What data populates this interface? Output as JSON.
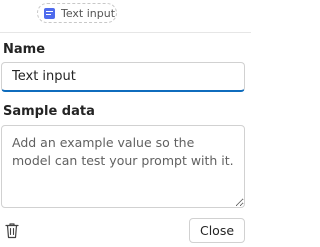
{
  "chip": {
    "label": "Text input",
    "icon": "text-input-icon",
    "icon_color": "#4f6bed"
  },
  "name_field": {
    "label": "Name",
    "value": "Text input"
  },
  "sample_field": {
    "label": "Sample data",
    "placeholder": "Add an example value so the model can test your prompt with it.",
    "value": ""
  },
  "actions": {
    "delete_icon": "trash-icon",
    "close_label": "Close"
  },
  "colors": {
    "accent": "#0f6cbd",
    "border": "#d1d1d1"
  }
}
